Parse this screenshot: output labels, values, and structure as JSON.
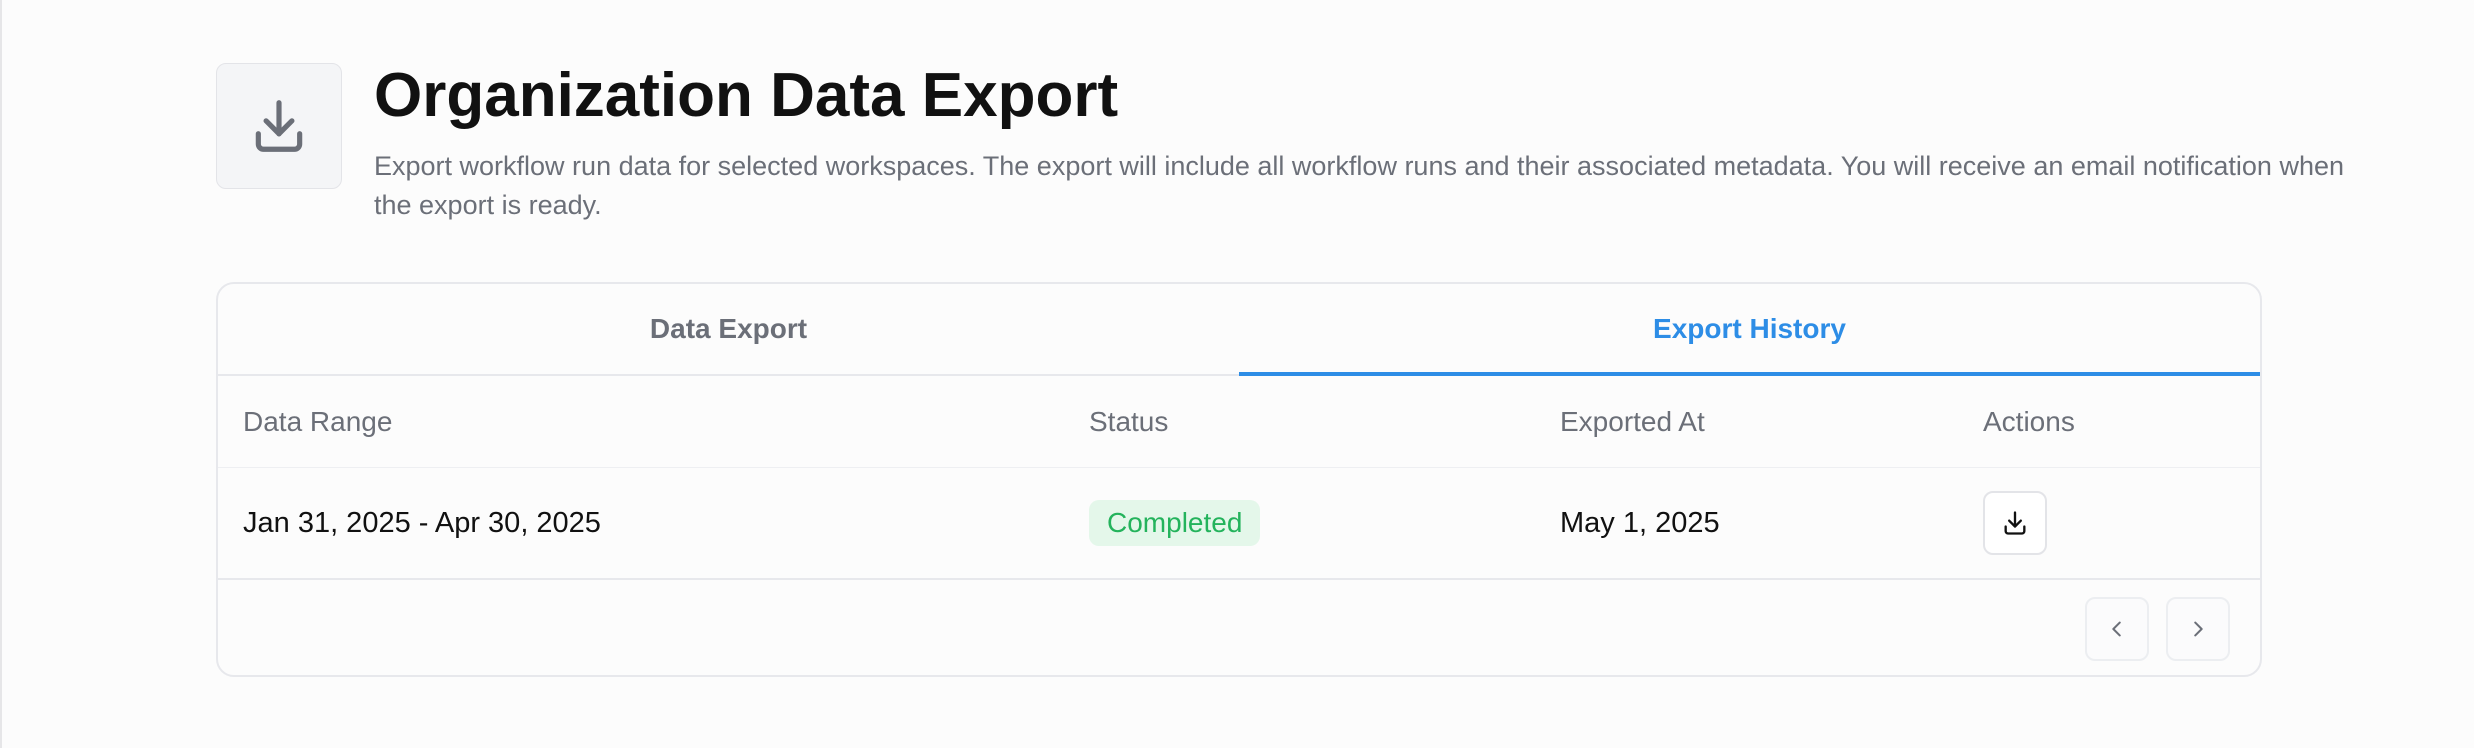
{
  "header": {
    "icon": "download-icon",
    "title": "Organization Data Export",
    "description": "Export workflow run data for selected workspaces. The export will include all workflow runs and their associated metadata. You will receive an email notification when the export is ready."
  },
  "tabs": [
    {
      "label": "Data Export",
      "active": false
    },
    {
      "label": "Export History",
      "active": true
    }
  ],
  "table": {
    "columns": [
      "Data Range",
      "Status",
      "Exported At",
      "Actions"
    ],
    "rows": [
      {
        "data_range": "Jan 31, 2025 - Apr 30, 2025",
        "status": "Completed",
        "exported_at": "May 1, 2025",
        "action_icon": "download-icon"
      }
    ]
  },
  "pagination": {
    "prev_icon": "chevron-left-icon",
    "next_icon": "chevron-right-icon"
  },
  "colors": {
    "accent": "#2d8de6",
    "success_text": "#24b35c",
    "success_bg": "#e4f7ea",
    "muted_text": "#6b6f78"
  }
}
